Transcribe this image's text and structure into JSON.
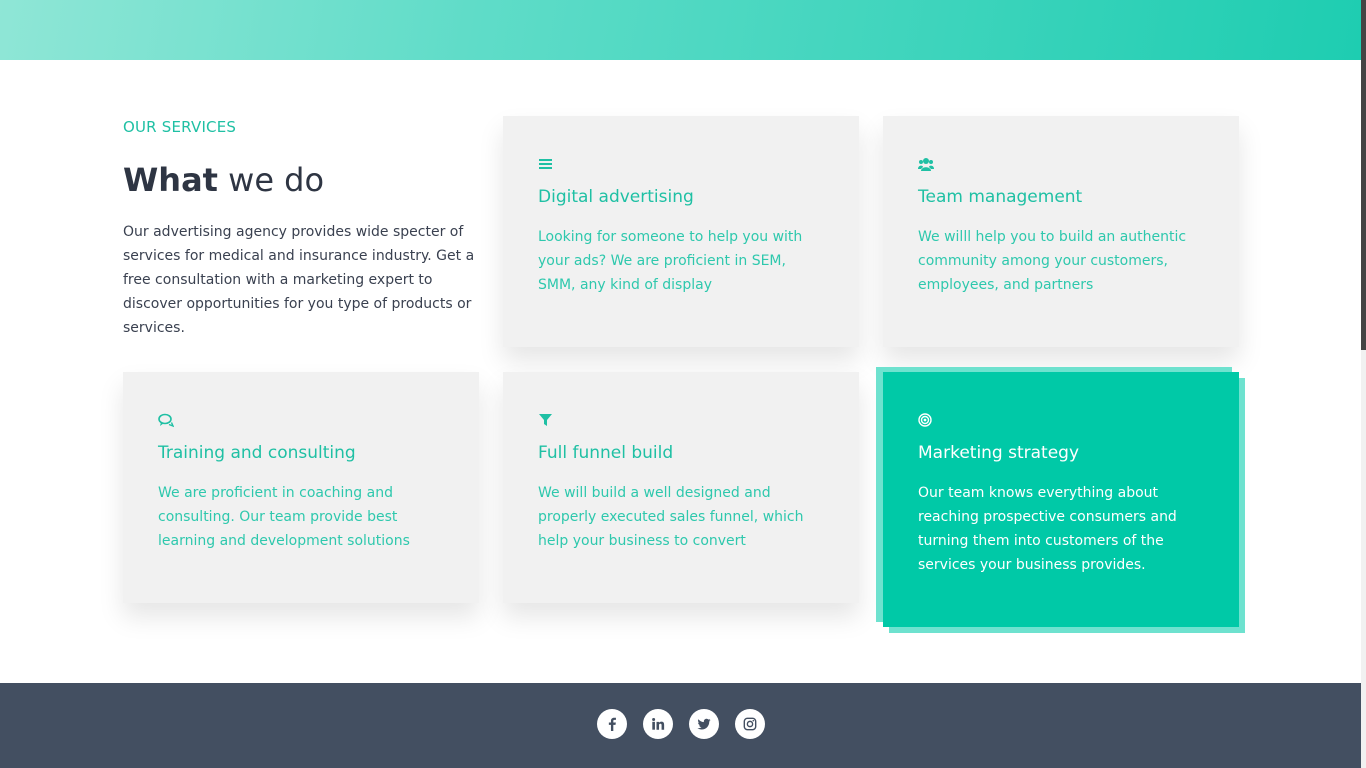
{
  "services": {
    "eyebrow": "OUR SERVICES",
    "heading_bold": "What",
    "heading_rest": " we do",
    "intro": "Our advertising agency provides wide specter of services for medical and insurance industry. Get a free consultation with a marketing expert to discover opportunities for you type of products or services."
  },
  "cards": [
    {
      "icon": "menu-icon",
      "title": "Digital advertising",
      "desc": "Looking for someone to help you with your ads? We are proficient in SEM, SMM, any kind of display"
    },
    {
      "icon": "users-icon",
      "title": "Team management",
      "desc": "We willl help you to build an authentic community among your customers, employees, and partners"
    },
    {
      "icon": "chat-bubbles-icon",
      "title": "Training and consulting",
      "desc": "We are proficient in coaching and consulting. Our team provide best learning and development solutions"
    },
    {
      "icon": "funnel-icon",
      "title": "Full funnel build",
      "desc": "We will build a well designed and properly executed sales funnel, which help your business to convert"
    },
    {
      "icon": "target-icon",
      "title": "Marketing strategy",
      "desc": "Our team knows everything about reaching prospective consumers and turning them into customers of the services your business provides."
    }
  ],
  "footer": {
    "social": [
      "facebook-icon",
      "linkedin-icon",
      "twitter-icon",
      "instagram-icon"
    ]
  },
  "colors": {
    "accent": "#1fc0a4",
    "active_card": "#00c9a7",
    "card_bg": "#f1f1f1",
    "footer_bg": "#434f61",
    "heading": "#2e3543"
  }
}
